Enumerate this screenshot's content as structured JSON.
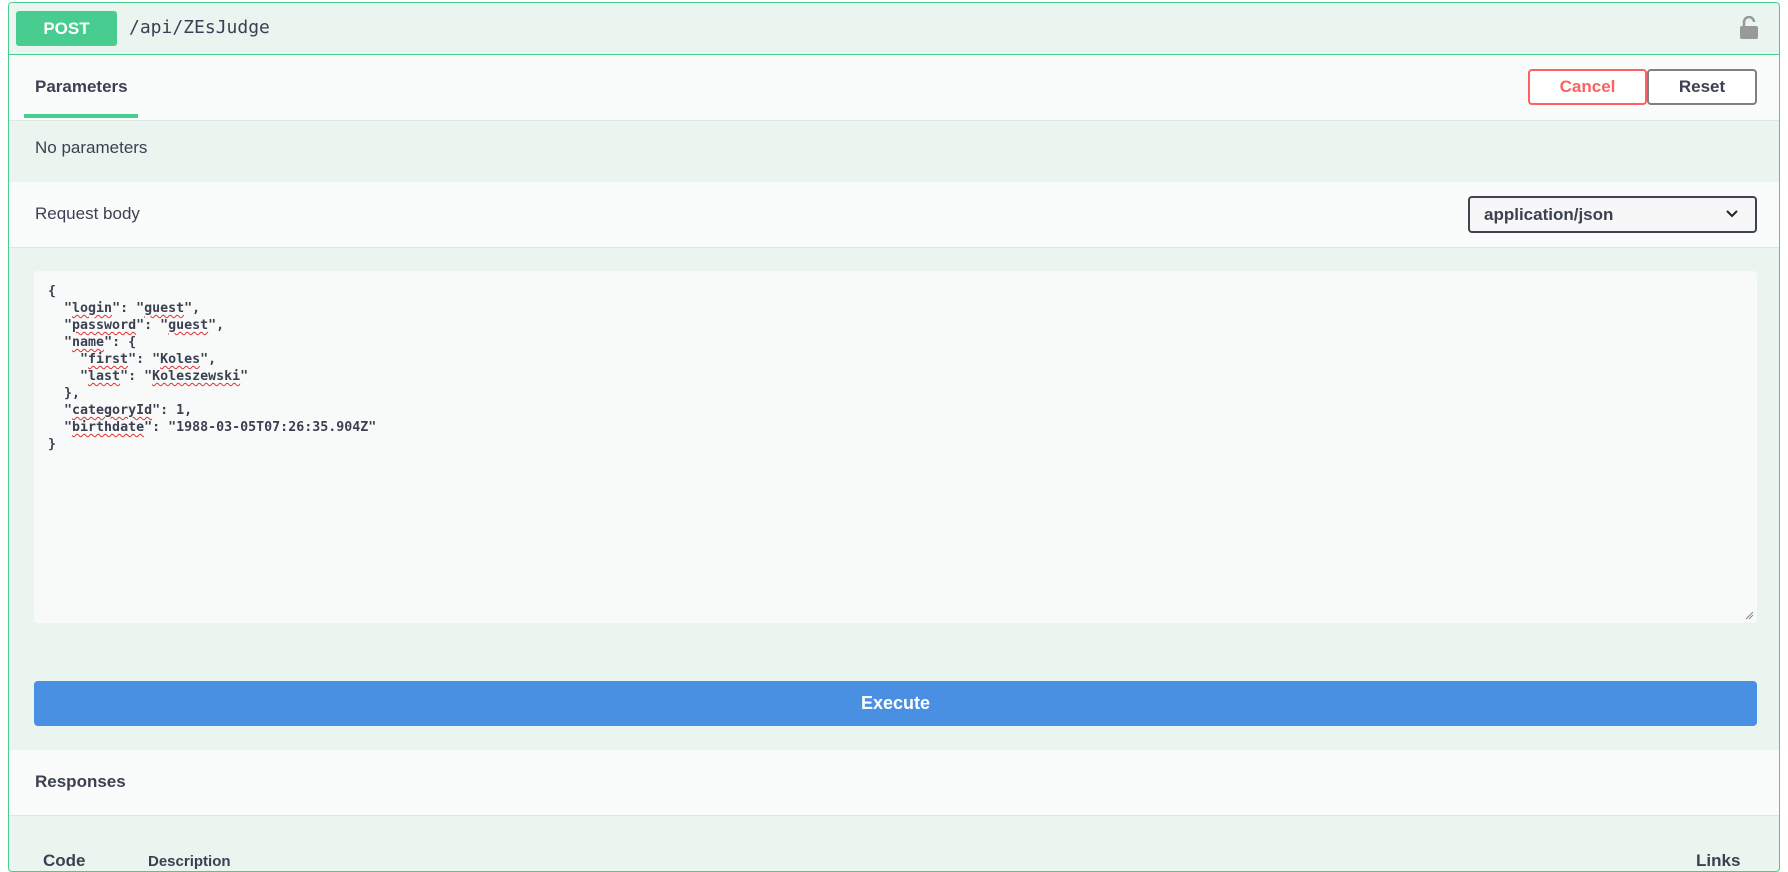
{
  "operation": {
    "method": "POST",
    "path": "/api/ZEsJudge"
  },
  "parameters": {
    "tab_label": "Parameters",
    "cancel_label": "Cancel",
    "reset_label": "Reset",
    "empty_text": "No parameters"
  },
  "request_body": {
    "label": "Request body",
    "content_type": "application/json",
    "json_lines": [
      "{",
      "  \"login\": \"guest\",",
      "  \"password\": \"guest\",",
      "  \"name\": {",
      "    \"first\": \"Koles\",",
      "    \"last\": \"Koleszewski\"",
      "  },",
      "  \"categoryId\": 1,",
      "  \"birthdate\": \"1988-03-05T07:26:35.904Z\"",
      "}"
    ]
  },
  "execute_label": "Execute",
  "responses": {
    "title": "Responses",
    "columns": [
      "Code",
      "Description",
      "Links"
    ]
  },
  "colors": {
    "post": "#49cc90",
    "execute": "#4990e2",
    "cancel": "#ff6060"
  }
}
